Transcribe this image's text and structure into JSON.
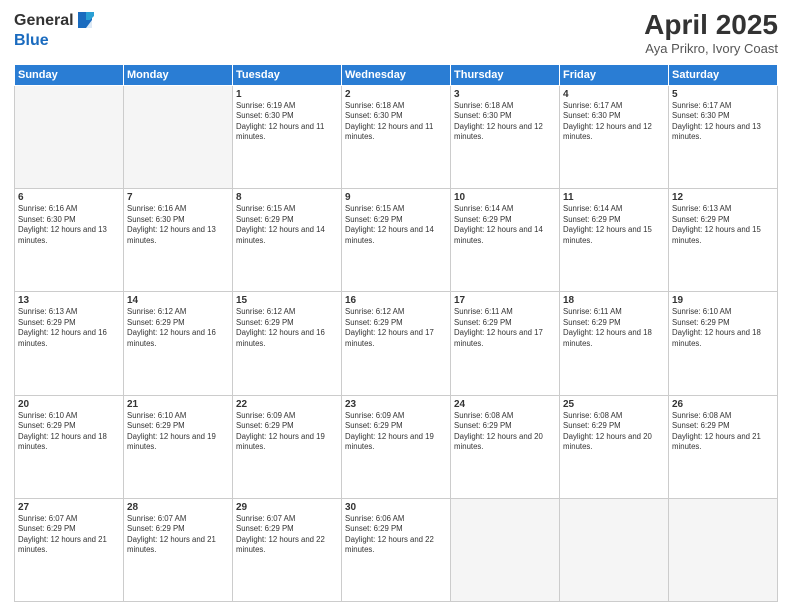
{
  "header": {
    "logo": {
      "line1": "General",
      "line2": "Blue"
    },
    "title": "April 2025",
    "subtitle": "Aya Prikro, Ivory Coast"
  },
  "weekdays": [
    "Sunday",
    "Monday",
    "Tuesday",
    "Wednesday",
    "Thursday",
    "Friday",
    "Saturday"
  ],
  "weeks": [
    [
      {
        "day": "",
        "info": ""
      },
      {
        "day": "",
        "info": ""
      },
      {
        "day": "1",
        "info": "Sunrise: 6:19 AM\nSunset: 6:30 PM\nDaylight: 12 hours and 11 minutes."
      },
      {
        "day": "2",
        "info": "Sunrise: 6:18 AM\nSunset: 6:30 PM\nDaylight: 12 hours and 11 minutes."
      },
      {
        "day": "3",
        "info": "Sunrise: 6:18 AM\nSunset: 6:30 PM\nDaylight: 12 hours and 12 minutes."
      },
      {
        "day": "4",
        "info": "Sunrise: 6:17 AM\nSunset: 6:30 PM\nDaylight: 12 hours and 12 minutes."
      },
      {
        "day": "5",
        "info": "Sunrise: 6:17 AM\nSunset: 6:30 PM\nDaylight: 12 hours and 13 minutes."
      }
    ],
    [
      {
        "day": "6",
        "info": "Sunrise: 6:16 AM\nSunset: 6:30 PM\nDaylight: 12 hours and 13 minutes."
      },
      {
        "day": "7",
        "info": "Sunrise: 6:16 AM\nSunset: 6:30 PM\nDaylight: 12 hours and 13 minutes."
      },
      {
        "day": "8",
        "info": "Sunrise: 6:15 AM\nSunset: 6:29 PM\nDaylight: 12 hours and 14 minutes."
      },
      {
        "day": "9",
        "info": "Sunrise: 6:15 AM\nSunset: 6:29 PM\nDaylight: 12 hours and 14 minutes."
      },
      {
        "day": "10",
        "info": "Sunrise: 6:14 AM\nSunset: 6:29 PM\nDaylight: 12 hours and 14 minutes."
      },
      {
        "day": "11",
        "info": "Sunrise: 6:14 AM\nSunset: 6:29 PM\nDaylight: 12 hours and 15 minutes."
      },
      {
        "day": "12",
        "info": "Sunrise: 6:13 AM\nSunset: 6:29 PM\nDaylight: 12 hours and 15 minutes."
      }
    ],
    [
      {
        "day": "13",
        "info": "Sunrise: 6:13 AM\nSunset: 6:29 PM\nDaylight: 12 hours and 16 minutes."
      },
      {
        "day": "14",
        "info": "Sunrise: 6:12 AM\nSunset: 6:29 PM\nDaylight: 12 hours and 16 minutes."
      },
      {
        "day": "15",
        "info": "Sunrise: 6:12 AM\nSunset: 6:29 PM\nDaylight: 12 hours and 16 minutes."
      },
      {
        "day": "16",
        "info": "Sunrise: 6:12 AM\nSunset: 6:29 PM\nDaylight: 12 hours and 17 minutes."
      },
      {
        "day": "17",
        "info": "Sunrise: 6:11 AM\nSunset: 6:29 PM\nDaylight: 12 hours and 17 minutes."
      },
      {
        "day": "18",
        "info": "Sunrise: 6:11 AM\nSunset: 6:29 PM\nDaylight: 12 hours and 18 minutes."
      },
      {
        "day": "19",
        "info": "Sunrise: 6:10 AM\nSunset: 6:29 PM\nDaylight: 12 hours and 18 minutes."
      }
    ],
    [
      {
        "day": "20",
        "info": "Sunrise: 6:10 AM\nSunset: 6:29 PM\nDaylight: 12 hours and 18 minutes."
      },
      {
        "day": "21",
        "info": "Sunrise: 6:10 AM\nSunset: 6:29 PM\nDaylight: 12 hours and 19 minutes."
      },
      {
        "day": "22",
        "info": "Sunrise: 6:09 AM\nSunset: 6:29 PM\nDaylight: 12 hours and 19 minutes."
      },
      {
        "day": "23",
        "info": "Sunrise: 6:09 AM\nSunset: 6:29 PM\nDaylight: 12 hours and 19 minutes."
      },
      {
        "day": "24",
        "info": "Sunrise: 6:08 AM\nSunset: 6:29 PM\nDaylight: 12 hours and 20 minutes."
      },
      {
        "day": "25",
        "info": "Sunrise: 6:08 AM\nSunset: 6:29 PM\nDaylight: 12 hours and 20 minutes."
      },
      {
        "day": "26",
        "info": "Sunrise: 6:08 AM\nSunset: 6:29 PM\nDaylight: 12 hours and 21 minutes."
      }
    ],
    [
      {
        "day": "27",
        "info": "Sunrise: 6:07 AM\nSunset: 6:29 PM\nDaylight: 12 hours and 21 minutes."
      },
      {
        "day": "28",
        "info": "Sunrise: 6:07 AM\nSunset: 6:29 PM\nDaylight: 12 hours and 21 minutes."
      },
      {
        "day": "29",
        "info": "Sunrise: 6:07 AM\nSunset: 6:29 PM\nDaylight: 12 hours and 22 minutes."
      },
      {
        "day": "30",
        "info": "Sunrise: 6:06 AM\nSunset: 6:29 PM\nDaylight: 12 hours and 22 minutes."
      },
      {
        "day": "",
        "info": ""
      },
      {
        "day": "",
        "info": ""
      },
      {
        "day": "",
        "info": ""
      }
    ]
  ]
}
